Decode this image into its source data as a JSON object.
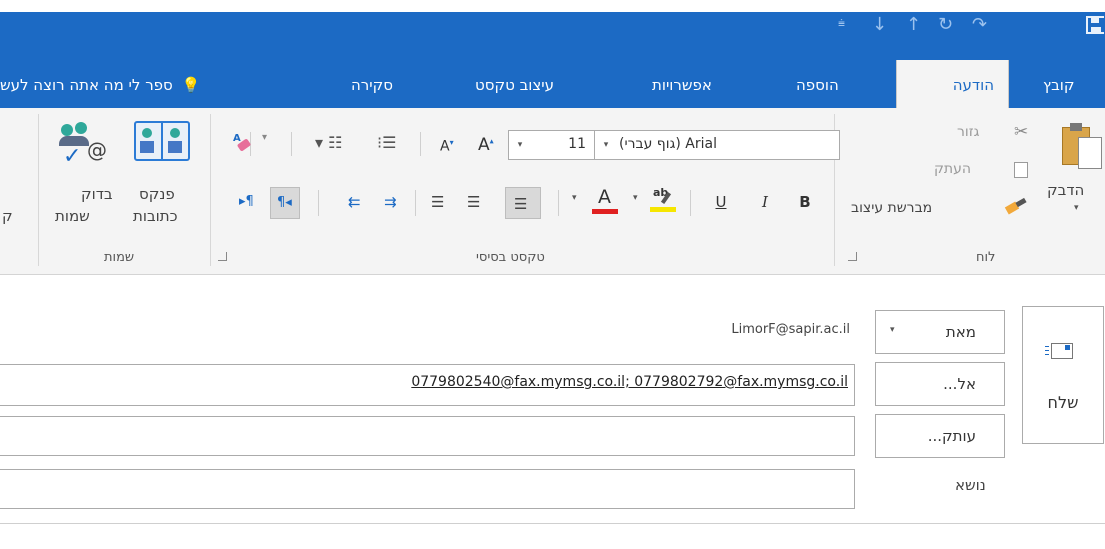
{
  "quick_access": {
    "icons": [
      "customize-icon",
      "download-arrow-icon",
      "upload-arrow-icon",
      "refresh-icon",
      "redo-icon",
      "save-icon"
    ]
  },
  "tabs": {
    "file": "קובץ",
    "message": "הודעה",
    "insert": "הוספה",
    "options": "אפשרויות",
    "format_text": "עיצוב טקסט",
    "review": "סקירה",
    "tell_me": "ספר לי מה אתה רוצה לעש"
  },
  "ribbon": {
    "clipboard": {
      "paste": "הדבק",
      "cut": "גזור",
      "copy": "העתק",
      "format_painter": "מברשת עיצוב",
      "label": "לוח"
    },
    "basic_text": {
      "font": "(גוף עברי) Arial",
      "size": "11",
      "bold": "B",
      "italic": "I",
      "underline": "U",
      "label": "טקסט בסיסי"
    },
    "names": {
      "address_book_1": "פנקס",
      "address_book_2": "כתובות",
      "check_names_1": "בדוק",
      "check_names_2": "שמות",
      "label": "שמות"
    },
    "clipped_next": "ק"
  },
  "compose": {
    "send": "שלח",
    "from_button": "מאת",
    "from_value": "LimorF@sapir.ac.il",
    "to_button": "אל...",
    "to_value": "0779802540@fax.mymsg.co.il; 0779802792@fax.mymsg.co.il",
    "cc_button": "עותק...",
    "cc_value": "",
    "subject_label": "נושא",
    "subject_value": ""
  },
  "colors": {
    "accent": "#1c6ac4",
    "font_color_bar": "#e02020",
    "highlight_bar": "#f6e600"
  }
}
